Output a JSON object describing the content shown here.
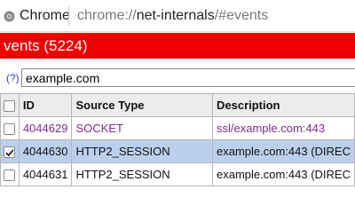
{
  "address_bar": {
    "origin_label": "Chrome",
    "url_scheme": "chrome://",
    "url_host": "net-internals",
    "url_path": "/#events"
  },
  "events_header": {
    "title": "vents (5224)"
  },
  "filter": {
    "help_link": "(?)",
    "value": "example.com"
  },
  "table": {
    "columns": [
      "ID",
      "Source Type",
      "Description"
    ],
    "rows": [
      {
        "id": "4044629",
        "source_type": "SOCKET",
        "description": "ssl/example.com:443",
        "checked": false
      },
      {
        "id": "4044630",
        "source_type": "HTTP2_SESSION",
        "description": "example.com:443 (DIREC",
        "checked": true
      },
      {
        "id": "4044631",
        "source_type": "HTTP2_SESSION",
        "description": "example.com:443 (DIREC",
        "checked": false
      }
    ]
  },
  "colors": {
    "header_red": "#ef0000",
    "selected_row": "#bcd0ee",
    "socket_text": "#7d2a8a",
    "link_blue": "#3b3bd6"
  },
  "icons": {
    "origin": "chrome-logo-icon",
    "checkbox_checked": "checkmark-icon"
  }
}
